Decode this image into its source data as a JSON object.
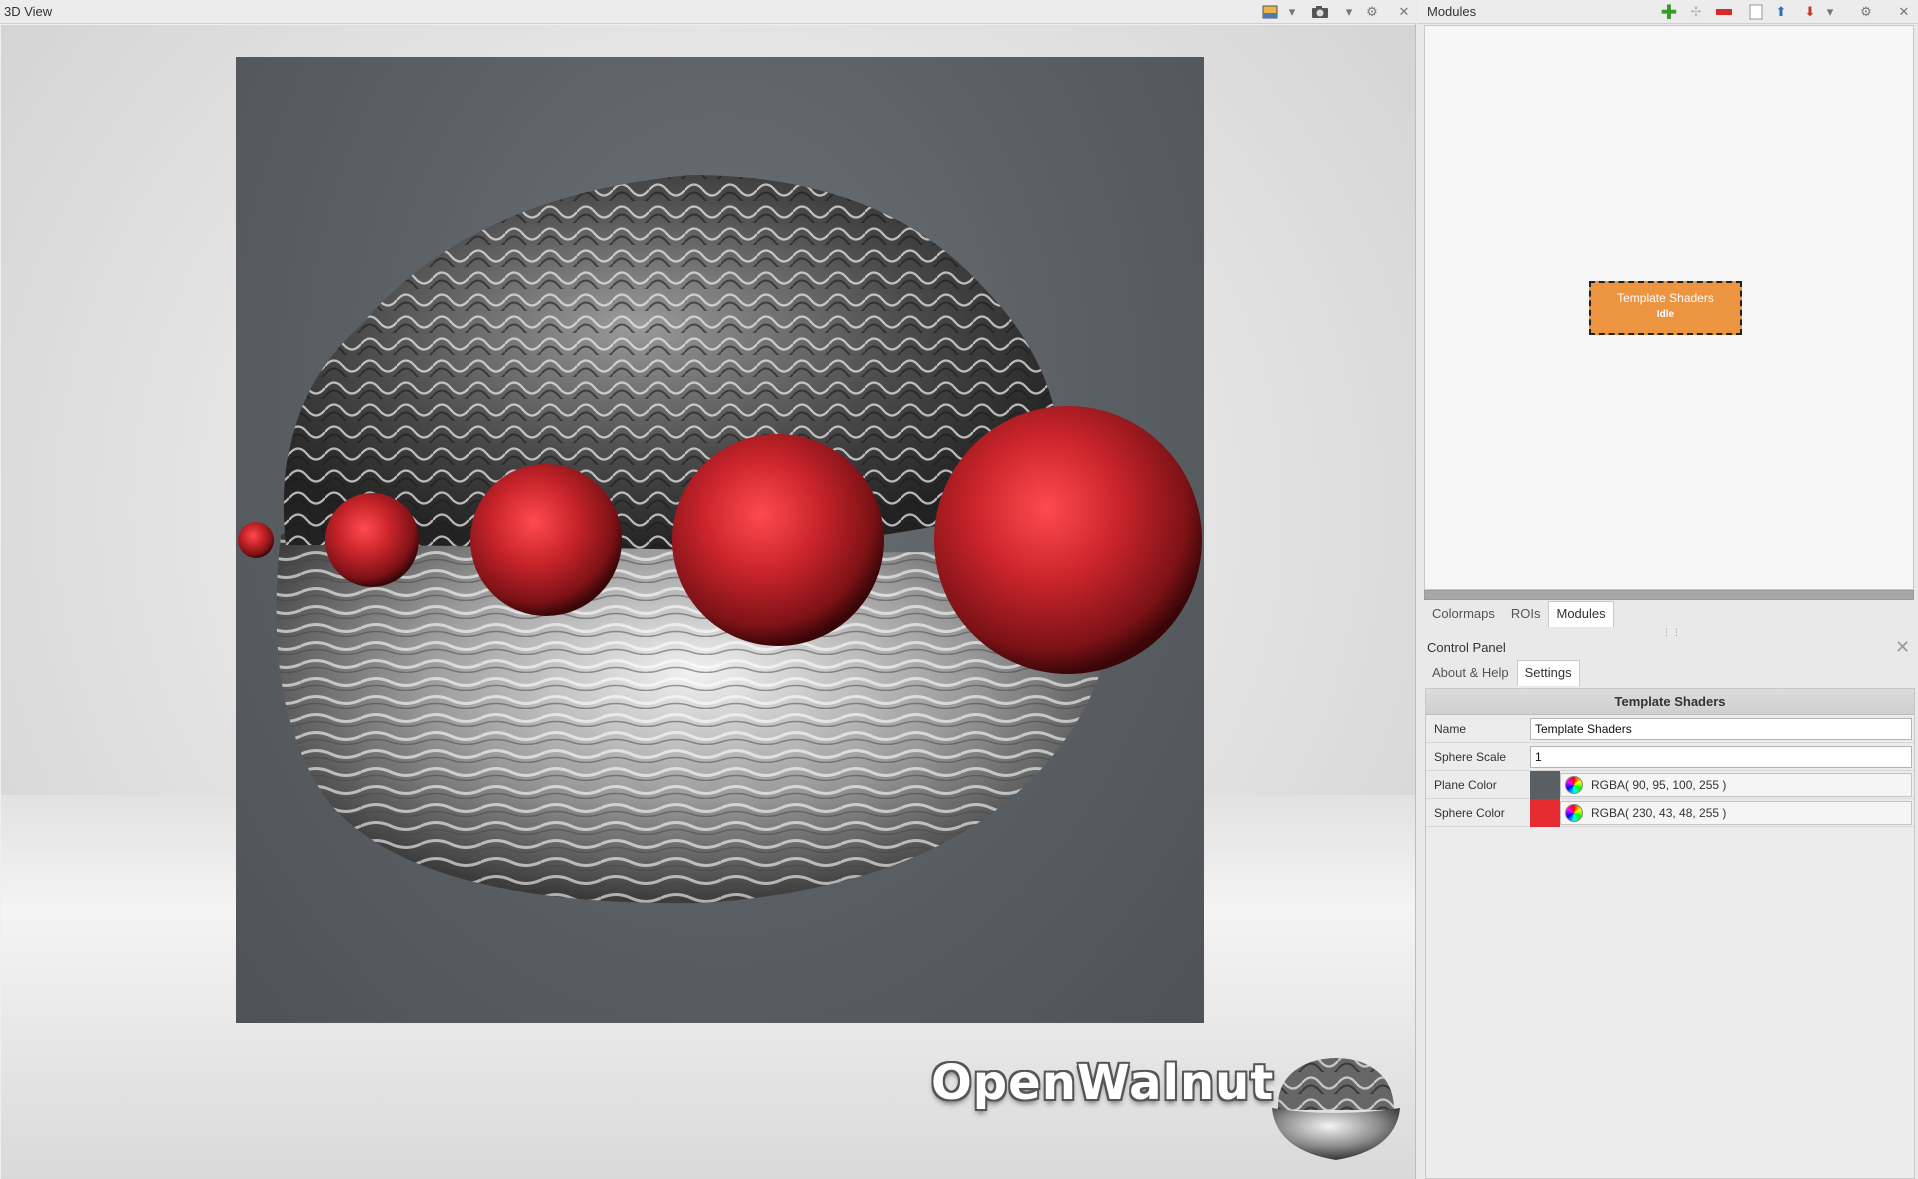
{
  "view3d": {
    "title": "3D View",
    "toolbar_icons": [
      "background-image-icon",
      "dropdown-icon",
      "camera-icon",
      "dropdown-icon",
      "settings-gear-icon",
      "close-icon"
    ]
  },
  "logo": {
    "text": "OpenWalnut"
  },
  "modules_panel": {
    "title": "Modules",
    "toolbar_icons": [
      "add-module-icon",
      "remove-module-icon",
      "new-project-icon",
      "load-project-icon",
      "save-project-icon",
      "settings-gear-icon",
      "close-icon"
    ],
    "node": {
      "name": "Template Shaders",
      "status": "Idle"
    }
  },
  "dock_tabs": [
    {
      "label": "Colormaps",
      "active": false
    },
    {
      "label": "ROIs",
      "active": false
    },
    {
      "label": "Modules",
      "active": true
    }
  ],
  "control_panel": {
    "title": "Control Panel",
    "tabs": [
      {
        "label": "About & Help",
        "active": false
      },
      {
        "label": "Settings",
        "active": true
      }
    ],
    "group_title": "Template Shaders",
    "properties": {
      "name": {
        "label": "Name",
        "value": "Template Shaders"
      },
      "sphere_scale": {
        "label": "Sphere Scale",
        "value": "1"
      },
      "plane_color": {
        "label": "Plane Color",
        "value": "RGBA( 90, 95, 100, 255 )",
        "swatch": "#5a5f64"
      },
      "sphere_color": {
        "label": "Sphere Color",
        "value": "RGBA( 230, 43, 48, 255 )",
        "swatch": "#e62b30"
      }
    }
  },
  "colors": {
    "module_node": "#ec9440",
    "plane": "#5a5f64",
    "sphere": "#e62b30"
  }
}
